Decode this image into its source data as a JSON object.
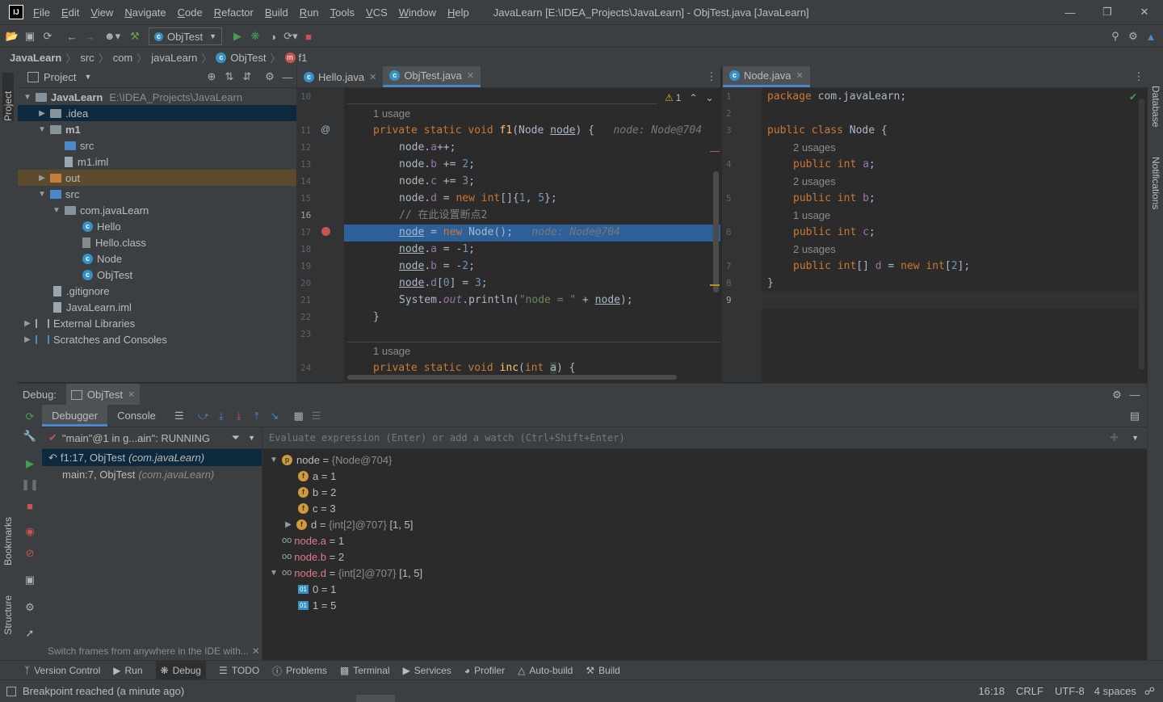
{
  "titlebar": {
    "menus": [
      "File",
      "Edit",
      "View",
      "Navigate",
      "Code",
      "Refactor",
      "Build",
      "Run",
      "Tools",
      "VCS",
      "Window",
      "Help"
    ],
    "title": "JavaLearn [E:\\IDEA_Projects\\JavaLearn] - ObjTest.java [JavaLearn]"
  },
  "toolbar": {
    "run_config": "ObjTest"
  },
  "breadcrumb": [
    "JavaLearn",
    "src",
    "com",
    "javaLearn",
    "ObjTest",
    "f1"
  ],
  "side_stripes": {
    "left_top": "Project",
    "left_bottom": [
      "Bookmarks",
      "Structure"
    ],
    "right": [
      "Database",
      "Notifications"
    ]
  },
  "project": {
    "title": "Project",
    "tree": [
      {
        "label": "JavaLearn",
        "extra": "E:\\IDEA_Projects\\JavaLearn"
      },
      {
        "label": ".idea"
      },
      {
        "label": "m1"
      },
      {
        "label": "src"
      },
      {
        "label": "m1.iml"
      },
      {
        "label": "out"
      },
      {
        "label": "src"
      },
      {
        "label": "com.javaLearn"
      },
      {
        "label": "Hello"
      },
      {
        "label": "Hello.class"
      },
      {
        "label": "Node"
      },
      {
        "label": "ObjTest"
      },
      {
        "label": ".gitignore"
      },
      {
        "label": "JavaLearn.iml"
      },
      {
        "label": "External Libraries"
      },
      {
        "label": "Scratches and Consoles"
      }
    ]
  },
  "editor_left": {
    "tabs": [
      "Hello.java",
      "ObjTest.java"
    ],
    "warning_count": "1",
    "line_numbers": [
      "10",
      "11",
      "12",
      "13",
      "14",
      "15",
      "16",
      "17",
      "18",
      "19",
      "20",
      "21",
      "22",
      "23",
      "24"
    ],
    "usage_hints": [
      "1 usage",
      "1 usage"
    ],
    "inlay_f1": "node: Node@704",
    "inlay_17": "node: Node@704",
    "comment": "// 在此设置断点2",
    "string_literal": "\"node = \""
  },
  "editor_right": {
    "tabs": [
      "Node.java"
    ],
    "line_numbers": [
      "1",
      "2",
      "3",
      "4",
      "5",
      "6",
      "7",
      "8",
      "9"
    ],
    "usages": [
      "2 usages",
      "2 usages",
      "1 usage",
      "2 usages"
    ]
  },
  "debug": {
    "label": "Debug:",
    "session": "ObjTest",
    "tabs": [
      "Debugger",
      "Console"
    ],
    "thread": "\"main\"@1 in g...ain\": RUNNING",
    "frames": [
      {
        "method": "f1:17, ObjTest",
        "pkg": "(com.javaLearn)"
      },
      {
        "method": "main:7, ObjTest",
        "pkg": "(com.javaLearn)"
      }
    ],
    "hint": "Switch frames from anywhere in the IDE with...",
    "eval_placeholder": "Evaluate expression (Enter) or add a watch (Ctrl+Shift+Enter)",
    "variables": [
      {
        "name": "node",
        "eq": " = ",
        "val": "{Node@704}",
        "gray": true
      },
      {
        "name": "a",
        "eq": " = ",
        "val": "1"
      },
      {
        "name": "b",
        "eq": " = ",
        "val": "2"
      },
      {
        "name": "c",
        "eq": " = ",
        "val": "3"
      },
      {
        "name": "d",
        "eq": " = ",
        "val": "{int[2]@707}",
        "val2": " [1, 5]"
      },
      {
        "name": "node.a",
        "eq": " = ",
        "val": "1"
      },
      {
        "name": "node.b",
        "eq": " = ",
        "val": "2"
      },
      {
        "name": "node.d",
        "eq": " = ",
        "val": "{int[2]@707}",
        "val2": " [1, 5]"
      },
      {
        "name": "0",
        "eq": " = ",
        "val": "1"
      },
      {
        "name": "1",
        "eq": " = ",
        "val": "5"
      }
    ]
  },
  "tool_strip": [
    "Version Control",
    "Run",
    "Debug",
    "TODO",
    "Problems",
    "Terminal",
    "Services",
    "Profiler",
    "Auto-build",
    "Build"
  ],
  "status": {
    "message": "Breakpoint reached (a minute ago)",
    "position": "16:18",
    "line_sep": "CRLF",
    "encoding": "UTF-8",
    "indent": "4 spaces"
  }
}
